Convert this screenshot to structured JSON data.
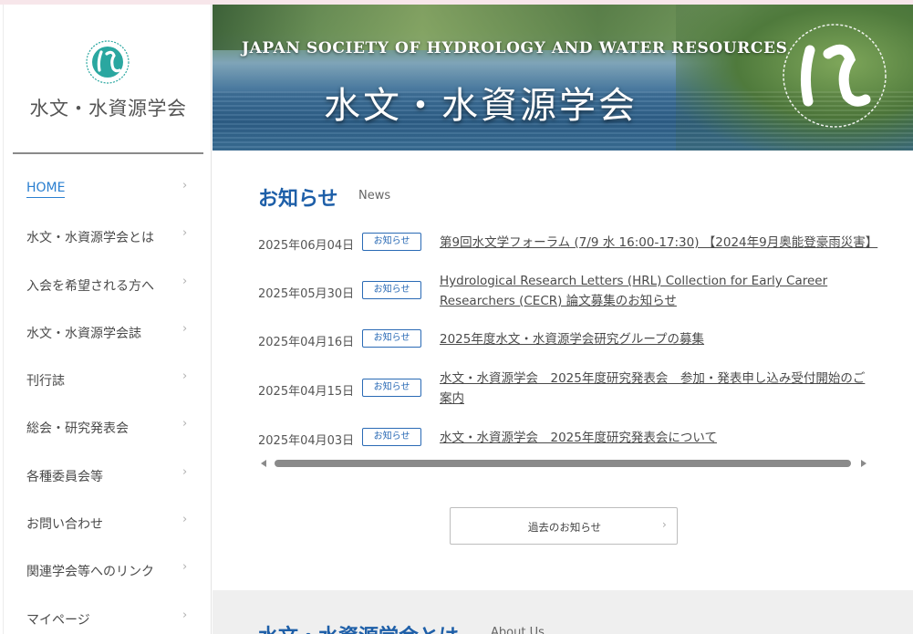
{
  "sidebar": {
    "logo_name": "水文・水資源学会",
    "nav": [
      {
        "label": "HOME",
        "active": true
      },
      {
        "label": "水文・水資源学会とは"
      },
      {
        "label": "入会を希望される方へ"
      },
      {
        "label": "水文・水資源学会誌"
      },
      {
        "label": "刊行誌"
      },
      {
        "label": "総会・研究発表会"
      },
      {
        "label": "各種委員会等"
      },
      {
        "label": "お問い合わせ"
      },
      {
        "label": "関連学会等へのリンク"
      },
      {
        "label": "マイページ"
      }
    ],
    "chevron": "›"
  },
  "banner": {
    "english": "JAPAN SOCIETY OF HYDROLOGY AND WATER RESOURCES",
    "japanese": "水文・水資源学会"
  },
  "news": {
    "title": "お知らせ",
    "subtitle": "News",
    "items": [
      {
        "date": "2025年06月04日",
        "tag": "お知らせ",
        "text": "第9回水文学フォーラム (7/9 水 16:00-17:30) 【2024年9月奥能登豪雨災害】"
      },
      {
        "date": "2025年05月30日",
        "tag": "お知らせ",
        "text": "Hydrological Research Letters (HRL) Collection for Early Career Researchers (CECR) 論文募集のお知らせ"
      },
      {
        "date": "2025年04月16日",
        "tag": "お知らせ",
        "text": "2025年度水文・水資源学会研究グループの募集"
      },
      {
        "date": "2025年04月15日",
        "tag": "お知らせ",
        "text": "水文・水資源学会　2025年度研究発表会　参加・発表申し込み受付開始のご案内"
      },
      {
        "date": "2025年04月03日",
        "tag": "お知らせ",
        "text": "水文・水資源学会　2025年度研究発表会について"
      }
    ],
    "more_label": "過去のお知らせ",
    "more_chevron": "›"
  },
  "about": {
    "title": "水文・水資源学会とは",
    "subtitle": "About Us"
  },
  "colors": {
    "accent": "#1e5fa8",
    "nav_active": "#2a7fd0",
    "tag_border": "#2a6ab5",
    "logo_teal": "#2aa7a0"
  }
}
